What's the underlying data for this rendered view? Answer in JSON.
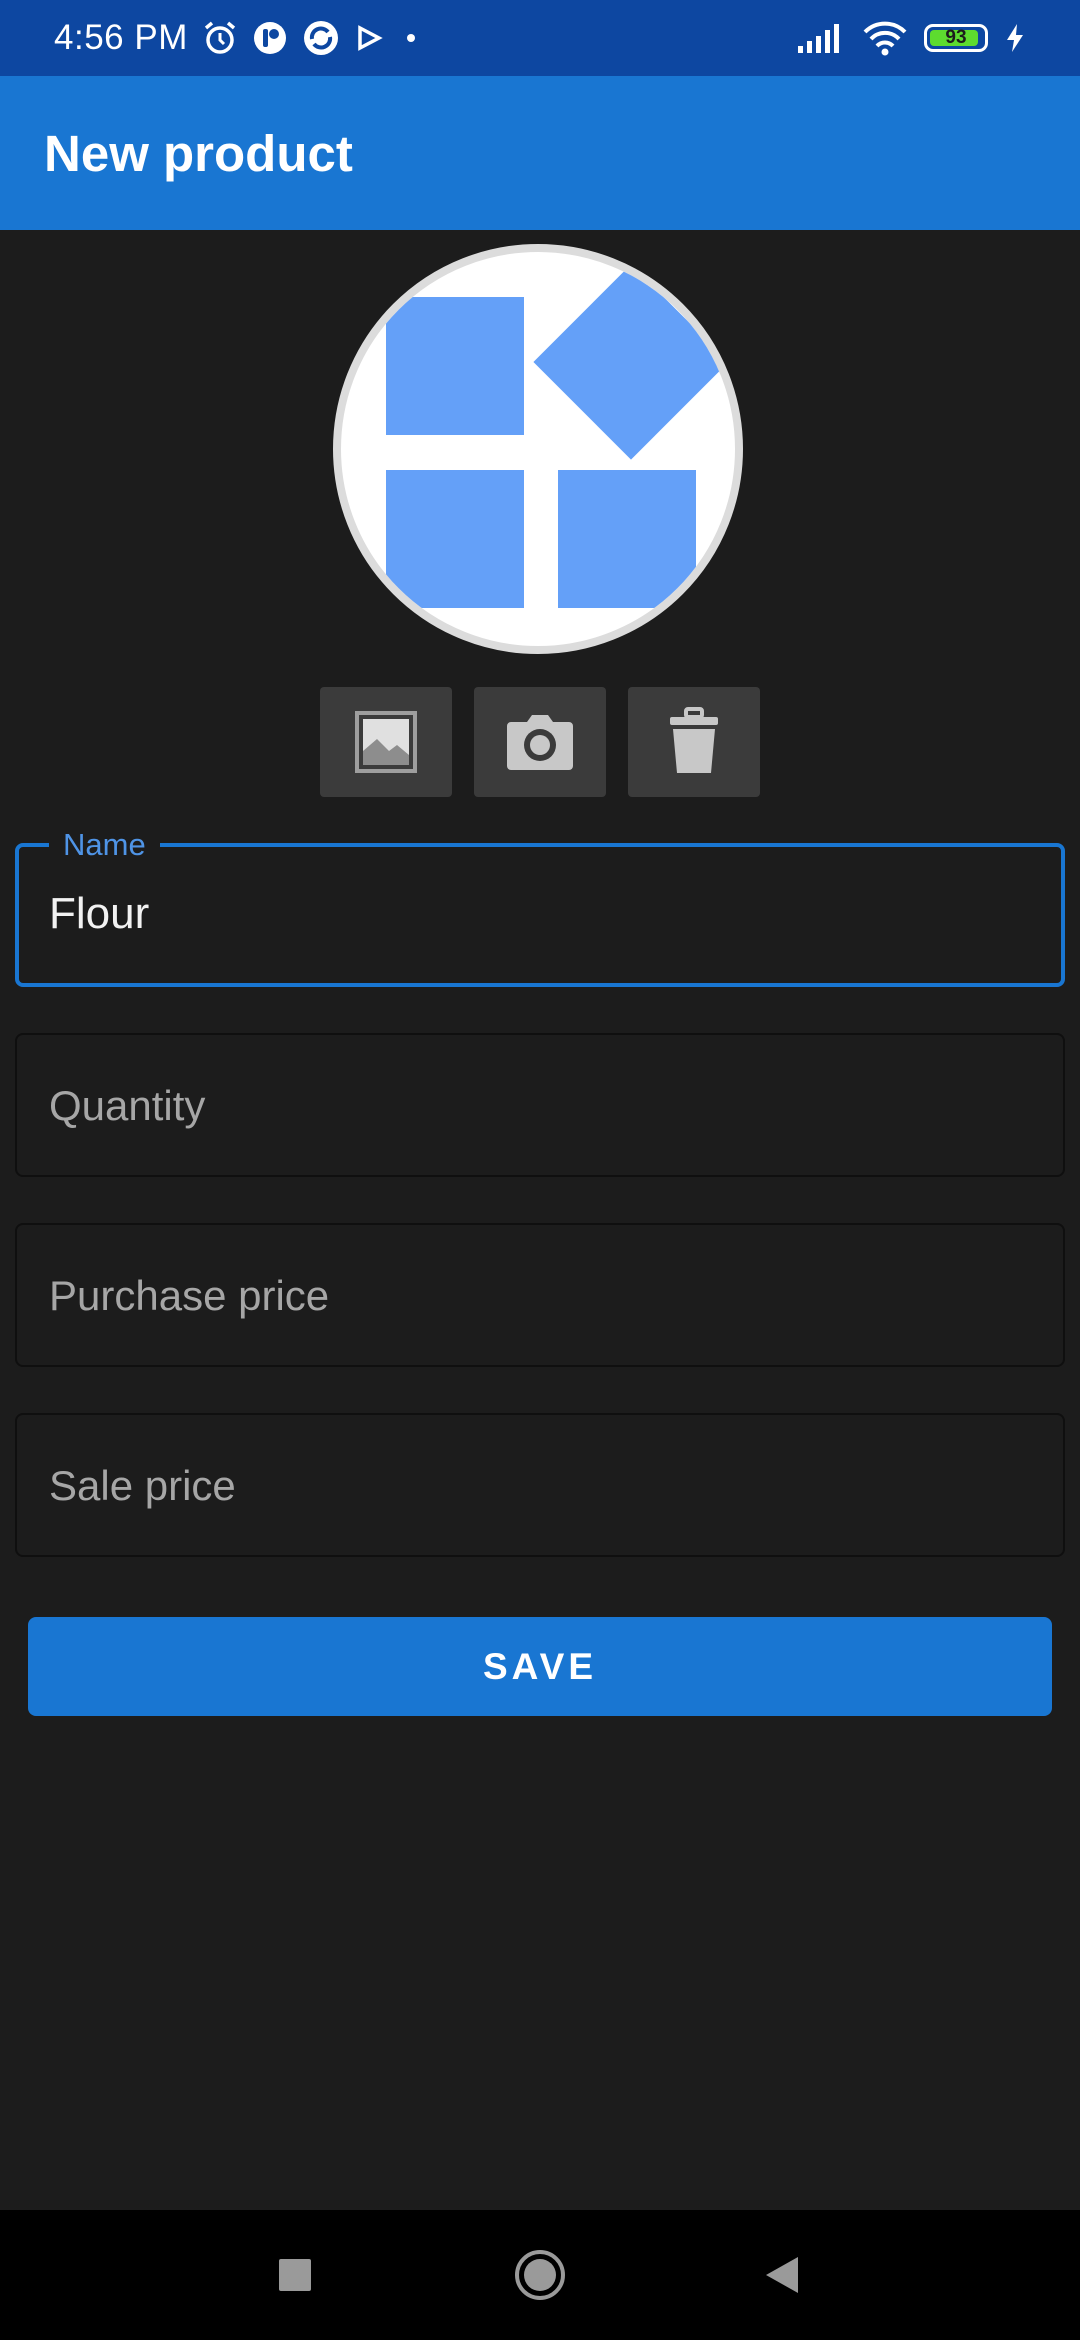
{
  "status_bar": {
    "time": "4:56 PM",
    "battery_level": "93",
    "battery_fraction": 0.93,
    "icons_left": [
      "alarm-icon",
      "app-notification-icon",
      "sync-app-icon",
      "play-store-icon",
      "dot-icon"
    ],
    "icons_right": [
      "cellular-signal-icon",
      "wifi-icon",
      "battery-icon",
      "charging-icon"
    ]
  },
  "app_bar": {
    "title": "New product"
  },
  "product_image": {
    "icon": "product-placeholder-icon",
    "color": "#64a0f8"
  },
  "image_actions": [
    {
      "icon": "gallery-icon"
    },
    {
      "icon": "camera-icon"
    },
    {
      "icon": "trash-icon"
    }
  ],
  "form": {
    "name": {
      "label": "Name",
      "value": "Flour"
    },
    "quantity": {
      "placeholder": "Quantity"
    },
    "purchase_price": {
      "placeholder": "Purchase price"
    },
    "sale_price": {
      "placeholder": "Sale price"
    }
  },
  "save_button": {
    "label": "SAVE"
  },
  "nav_bar": {
    "icons": [
      "recent-apps-icon",
      "home-icon",
      "back-icon"
    ]
  },
  "colors": {
    "status_bar": "#0d47a1",
    "app_bar": "#1976d2",
    "background": "#1c1c1c",
    "accent": "#1976d2"
  }
}
